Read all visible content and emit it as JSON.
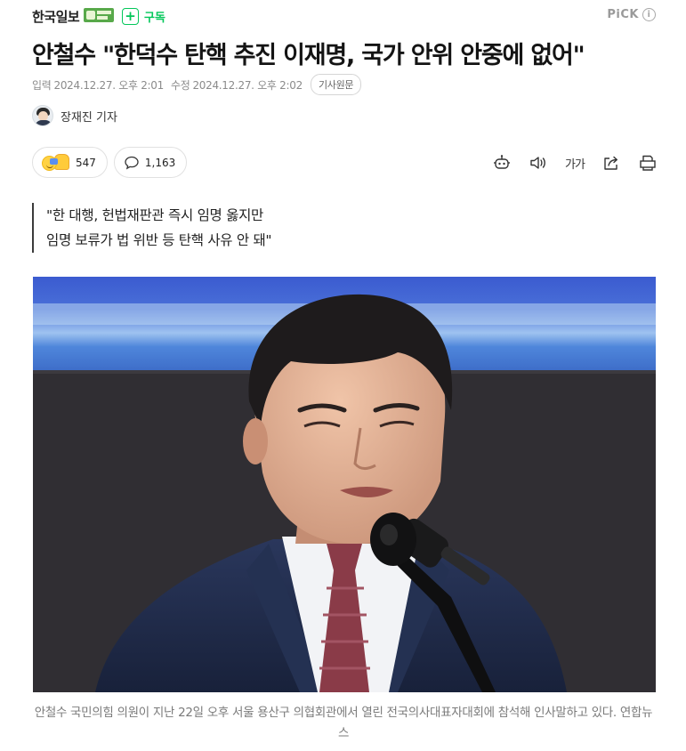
{
  "header": {
    "press_name": "한국일보",
    "subscribe_label": "구독",
    "pick_label": "PiCK",
    "info_symbol": "i"
  },
  "article": {
    "headline": "안철수 \"한덕수 탄핵 추진 이재명, 국가 안위 안중에 없어\"",
    "published_label": "입력",
    "published_value": "2024.12.27. 오후 2:01",
    "modified_label": "수정",
    "modified_value": "2024.12.27. 오후 2:02",
    "original_link_label": "기사원문",
    "reporter": "장재진 기자"
  },
  "reactions": {
    "reaction_count": "547",
    "comment_count": "1,163"
  },
  "toolbar": {
    "font_size_label": "가가"
  },
  "summary": {
    "line1": "\"한 대행, 헌법재판관 즉시 임명 옳지만",
    "line2": "임명 보류가 법 위반 등 탄핵 사유 안 돼\""
  },
  "photo": {
    "caption": "안철수 국민의힘 의원이 지난 22일 오후 서울 용산구 의협회관에서 열린 전국의사대표자대회에 참석해 인사말하고 있다. 연합뉴스"
  },
  "colors": {
    "brand_green": "#03c75a",
    "backdrop_blue": "#3a63c9",
    "backdrop_dark": "#2d2b2e",
    "suit_navy": "#1e2a4a",
    "tie_red": "#8a3b48"
  },
  "icons": [
    "plus-icon",
    "info-icon",
    "reaction-emoji-icon",
    "comment-icon",
    "summary-bot-icon",
    "audio-icon",
    "font-size-icon",
    "share-icon",
    "print-icon"
  ]
}
